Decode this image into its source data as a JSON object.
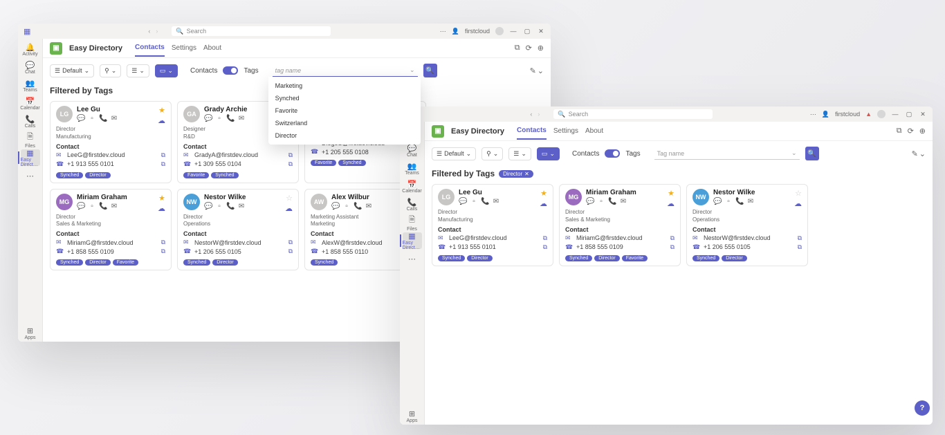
{
  "titlebar": {
    "search_placeholder": "Search",
    "user1": "firstcloud",
    "user2": "firstcloud"
  },
  "leftnav": {
    "items": [
      {
        "label": "Activity",
        "icon": "🔔"
      },
      {
        "label": "Chat",
        "icon": "💬"
      },
      {
        "label": "Teams",
        "icon": "👥"
      },
      {
        "label": "Calendar",
        "icon": "📅"
      },
      {
        "label": "Calls",
        "icon": "📞"
      },
      {
        "label": "Files",
        "icon": "🗎"
      },
      {
        "label": "Easy Direct…",
        "icon": "▦"
      },
      {
        "label": "",
        "icon": "⋯"
      },
      {
        "label": "Apps",
        "icon": "⊞"
      }
    ]
  },
  "app": {
    "title": "Easy Directory",
    "tabs": [
      "Contacts",
      "Settings",
      "About"
    ]
  },
  "toolbar": {
    "default_label": "Default",
    "contacts_label": "Contacts",
    "tags_label": "Tags",
    "tag_placeholder_left": "tag name",
    "tag_placeholder_right": "Tag name"
  },
  "dropdown": {
    "items": [
      "Marketing",
      "Synched",
      "Favorite",
      "Switzerland",
      "Director"
    ]
  },
  "section": {
    "filtered_label": "Filtered by Tags",
    "filter_chip": "Director"
  },
  "cards_left": [
    {
      "name": "Lee Gu",
      "fav": true,
      "avatar": "LG",
      "title1": "Director",
      "title2": "Manufacturing",
      "email": "LeeG@firstdev.cloud",
      "phone": "+1 913 555 0101",
      "chips": [
        "Synched",
        "Director"
      ]
    },
    {
      "name": "Grady Archie",
      "fav": false,
      "avatar": "GA",
      "title1": "Designer",
      "title2": "R&D",
      "email": "GradyA@firstdev.cloud",
      "phone": "+1 309 555 0104",
      "chips": [
        "Favorite",
        "Synched"
      ]
    },
    {
      "name": "",
      "fav": false,
      "avatar": "",
      "title1": "",
      "title2": "",
      "email": "DiegoS@firstdev.cloud",
      "phone": "+1 205 555 0108",
      "chips": [
        "Favorite",
        "Synched"
      ]
    },
    {
      "name": "Miriam Graham",
      "fav": true,
      "avatar": "MG",
      "title1": "Director",
      "title2": "Sales & Marketing",
      "email": "MiriamG@firstdev.cloud",
      "phone": "+1 858 555 0109",
      "chips": [
        "Synched",
        "Director",
        "Favorite"
      ]
    },
    {
      "name": "Nestor Wilke",
      "fav": false,
      "avatar": "NW",
      "title1": "Director",
      "title2": "Operations",
      "email": "NestorW@firstdev.cloud",
      "phone": "+1 206 555 0105",
      "chips": [
        "Synched",
        "Director"
      ]
    },
    {
      "name": "Alex Wilbur",
      "fav": false,
      "avatar": "AW",
      "title1": "Marketing Assistant",
      "title2": "Marketing",
      "email": "AlexW@firstdev.cloud",
      "phone": "+1 858 555 0110",
      "chips": [
        "Synched"
      ]
    }
  ],
  "cards_right": [
    {
      "name": "Lee Gu",
      "fav": true,
      "avatar": "LG",
      "title1": "Director",
      "title2": "Manufacturing",
      "email": "LeeG@firstdev.cloud",
      "phone": "+1 913 555 0101",
      "chips": [
        "Synched",
        "Director"
      ]
    },
    {
      "name": "Miriam Graham",
      "fav": true,
      "avatar": "MG",
      "title1": "Director",
      "title2": "Sales & Marketing",
      "email": "MiriamG@firstdev.cloud",
      "phone": "+1 858 555 0109",
      "chips": [
        "Synched",
        "Director",
        "Favorite"
      ]
    },
    {
      "name": "Nestor Wilke",
      "fav": false,
      "avatar": "NW",
      "title1": "Director",
      "title2": "Operations",
      "email": "NestorW@firstdev.cloud",
      "phone": "+1 206 555 0105",
      "chips": [
        "Synched",
        "Director"
      ]
    }
  ],
  "contact_label": "Contact"
}
